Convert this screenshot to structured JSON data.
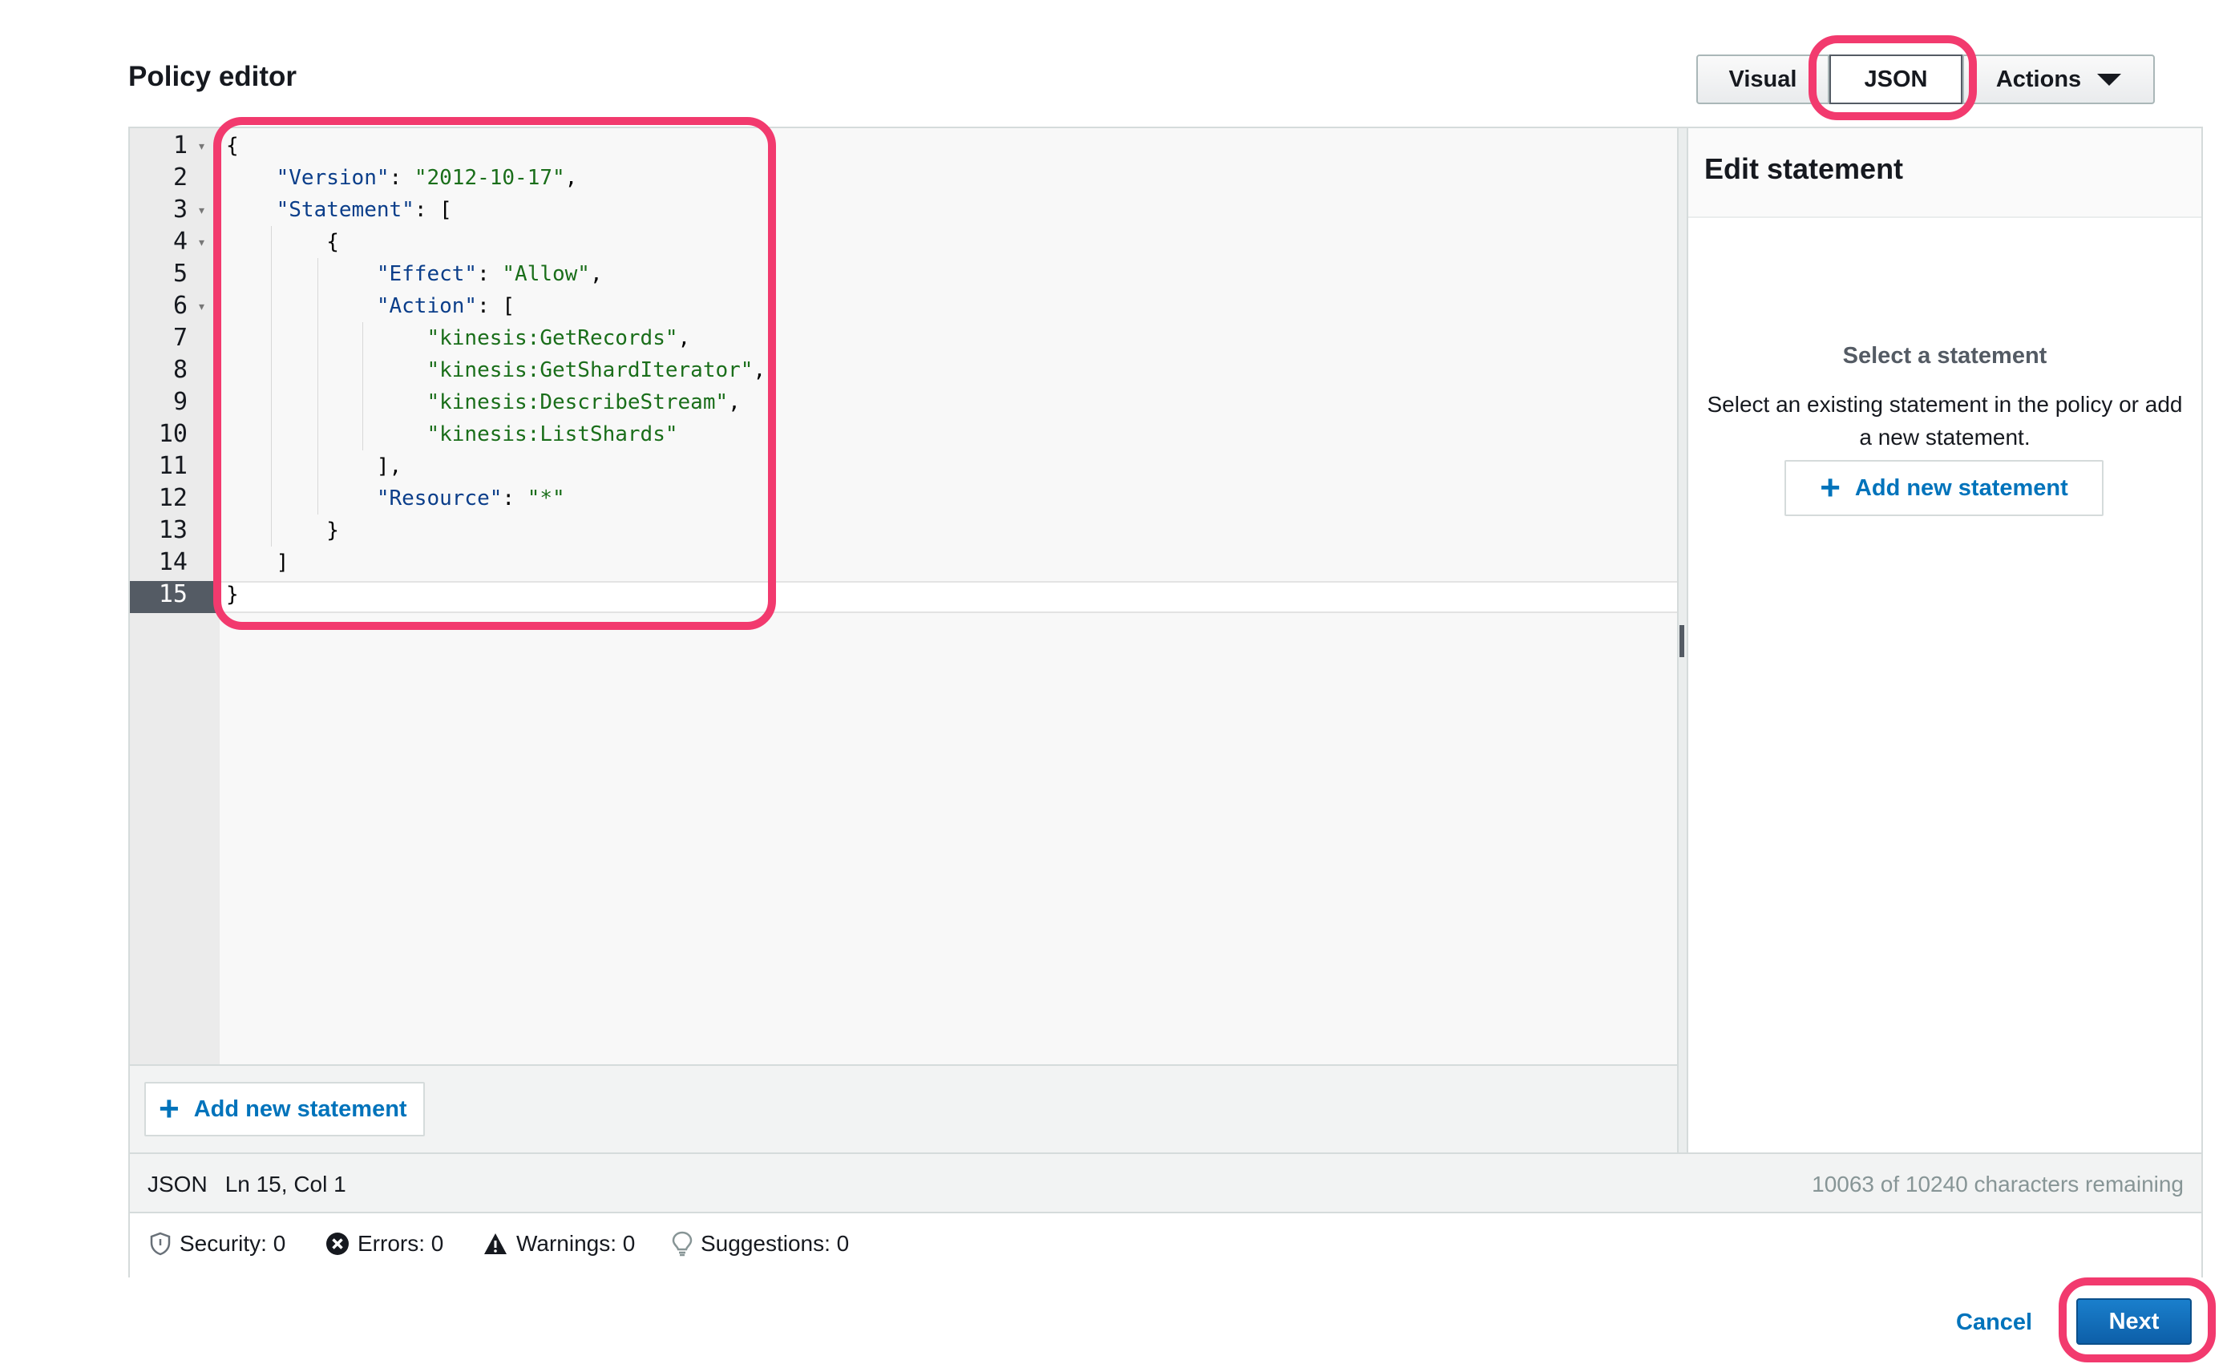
{
  "header": {
    "title": "Policy editor"
  },
  "mode_toggle": {
    "visual": "Visual",
    "json": "JSON",
    "actions": "Actions"
  },
  "editor": {
    "line_numbers": [
      "1",
      "2",
      "3",
      "4",
      "5",
      "6",
      "7",
      "8",
      "9",
      "10",
      "11",
      "12",
      "13",
      "14",
      "15"
    ],
    "code": {
      "l1": "{",
      "l2_key": "\"Version\"",
      "l2_val": "\"2012-10-17\"",
      "l3_key": "\"Statement\"",
      "l3_rest": "[",
      "l4": "{",
      "l5_key": "\"Effect\"",
      "l5_val": "\"Allow\"",
      "l6_key": "\"Action\"",
      "l6_rest": "[",
      "l7": "\"kinesis:GetRecords\"",
      "l8": "\"kinesis:GetShardIterator\"",
      "l9": "\"kinesis:DescribeStream\"",
      "l10": "\"kinesis:ListShards\"",
      "l11": "],",
      "l12_key": "\"Resource\"",
      "l12_val": "\"*\"",
      "l13": "}",
      "l14": "]",
      "l15": "}"
    },
    "add_statement": "Add new statement"
  },
  "right_panel": {
    "title": "Edit statement",
    "subtitle": "Select a statement",
    "description": "Select an existing statement in the policy or add a new statement.",
    "add_statement": "Add new statement"
  },
  "status": {
    "mode": "JSON",
    "position": "Ln 15, Col 1",
    "remaining": "10063 of 10240 characters remaining"
  },
  "issues": {
    "security": "Security: 0",
    "errors": "Errors: 0",
    "warnings": "Warnings: 0",
    "suggestions": "Suggestions: 0"
  },
  "footer": {
    "cancel": "Cancel",
    "next": "Next"
  },
  "colors": {
    "highlight": "#f23a6e",
    "primary": "#0073bb",
    "next_button": "#1a7fcc"
  }
}
